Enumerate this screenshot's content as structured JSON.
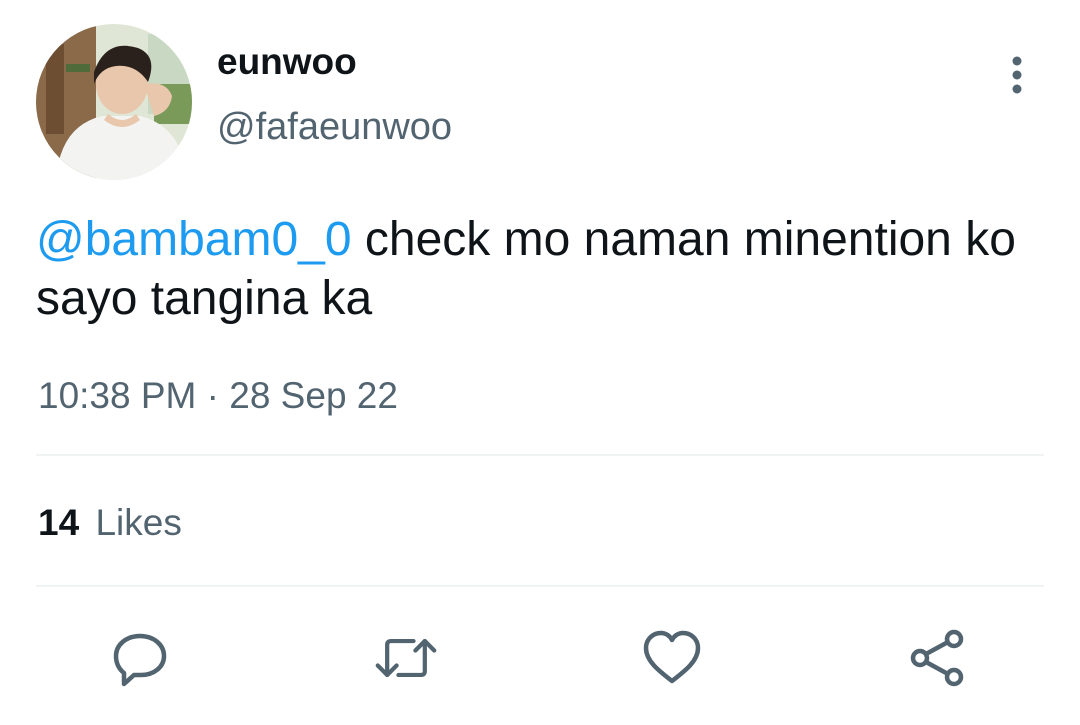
{
  "user": {
    "display_name": "eunwoo",
    "handle": "@fafaeunwoo"
  },
  "tweet": {
    "mention": "@bambam0_0",
    "text": " check mo naman minention ko sayo tangina ka",
    "timestamp": "10:38 PM · 28 Sep 22"
  },
  "stats": {
    "likes_count": "14",
    "likes_label": "Likes"
  },
  "icons": {
    "more": "more-vertical-icon",
    "reply": "reply-icon",
    "retweet": "retweet-icon",
    "like": "heart-icon",
    "share": "share-icon"
  },
  "colors": {
    "link": "#1d9bf0",
    "secondary_text": "#536471",
    "primary_text": "#0f1419",
    "divider": "#eff3f4"
  }
}
